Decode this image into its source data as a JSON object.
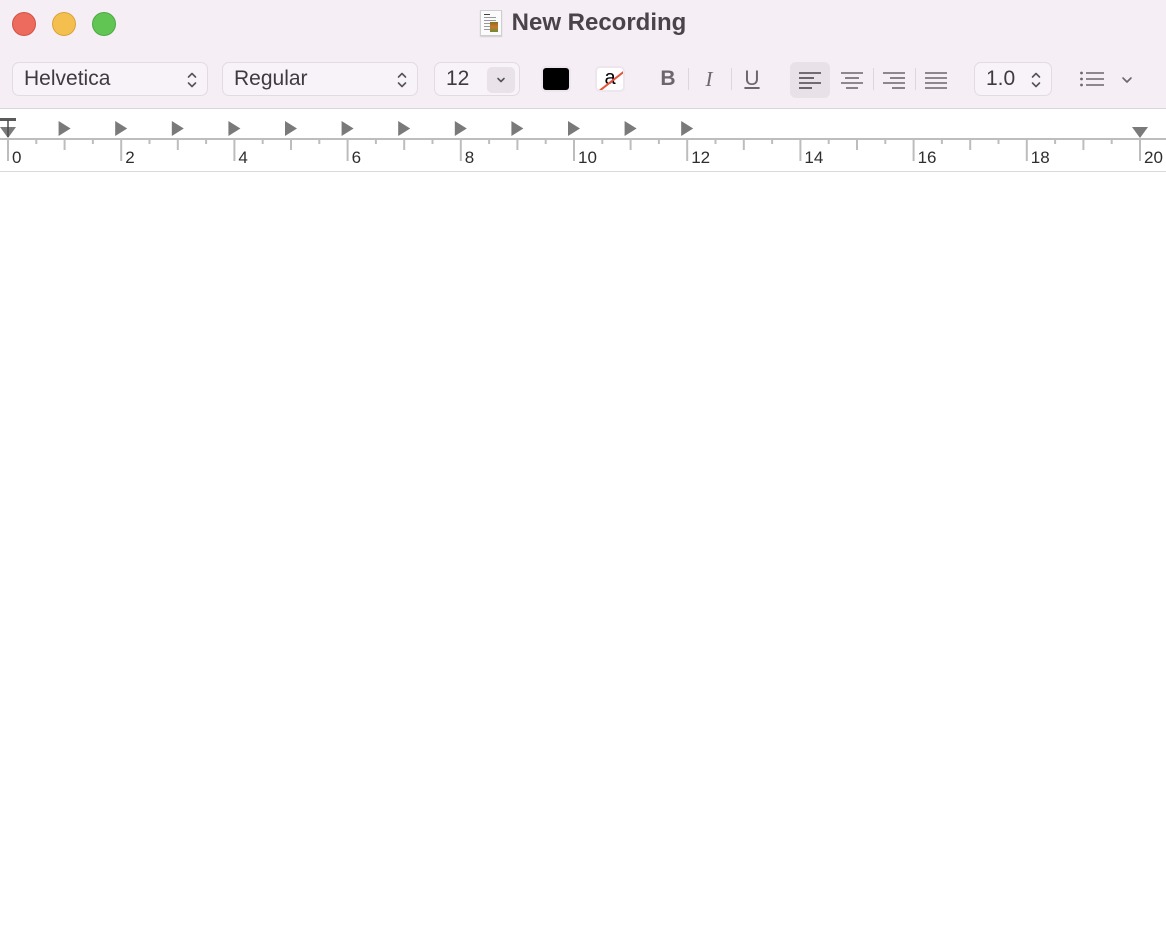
{
  "window": {
    "title": "New Recording",
    "title_icon": "rich-text-document-icon",
    "controls": {
      "close": {
        "icon": "close-icon",
        "color": "#ec6a5e"
      },
      "minimize": {
        "icon": "minimize-icon",
        "color": "#f5bf4f"
      },
      "maximize": {
        "icon": "maximize-icon",
        "color": "#61c554"
      }
    }
  },
  "toolbar": {
    "font_family": {
      "value": "Helvetica",
      "icon": "up-down-chevron-icon"
    },
    "font_style": {
      "value": "Regular",
      "icon": "up-down-chevron-icon"
    },
    "font_size": {
      "value": "12",
      "icon": "chevron-down-icon"
    },
    "text_color": {
      "value": "#000000",
      "icon": "text-color-swatch"
    },
    "background_color": {
      "label": "a",
      "value": "none",
      "icon": "no-highlight-swatch"
    },
    "bold_label": "B",
    "italic_label": "I",
    "underline_label": "U",
    "alignment": {
      "selected": "left",
      "options": [
        {
          "name": "left",
          "icon": "align-left-icon"
        },
        {
          "name": "center",
          "icon": "align-center-icon"
        },
        {
          "name": "right",
          "icon": "align-right-icon"
        },
        {
          "name": "justify",
          "icon": "align-justify-icon"
        }
      ]
    },
    "line_spacing": {
      "value": "1.0",
      "icon": "up-down-chevron-icon"
    },
    "list": {
      "icon": "bulleted-list-icon",
      "dropdown_icon": "chevron-down-icon"
    }
  },
  "ruler": {
    "unit_labels": [
      "0",
      "2",
      "4",
      "6",
      "8",
      "10",
      "12",
      "14",
      "16",
      "18",
      "20"
    ],
    "tab_stops": [
      1,
      2,
      3,
      4,
      5,
      6,
      7,
      8,
      9,
      10,
      11,
      12
    ],
    "first_line_indent": 0,
    "left_margin": 0,
    "right_margin": 20
  },
  "document": {
    "content": ""
  }
}
